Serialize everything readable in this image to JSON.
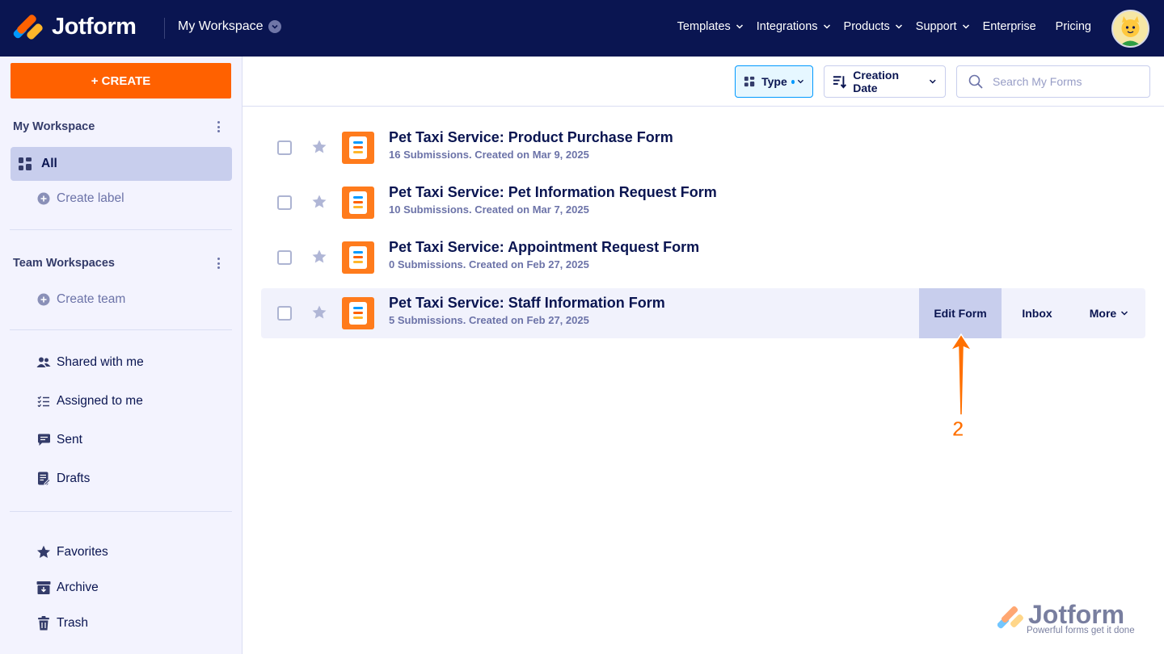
{
  "brand": {
    "name": "Jotform"
  },
  "header": {
    "workspace_label": "My Workspace",
    "nav": [
      {
        "label": "Templates",
        "has_menu": true
      },
      {
        "label": "Integrations",
        "has_menu": true
      },
      {
        "label": "Products",
        "has_menu": true
      },
      {
        "label": "Support",
        "has_menu": true
      },
      {
        "label": "Enterprise",
        "has_menu": false
      },
      {
        "label": "Pricing",
        "has_menu": false
      }
    ]
  },
  "sidebar": {
    "create_label": "+ CREATE",
    "my_workspace_title": "My Workspace",
    "all_label": "All",
    "create_label_link": "Create label",
    "team_workspaces_title": "Team Workspaces",
    "create_team_link": "Create team",
    "items": [
      {
        "label": "Shared with me",
        "icon": "users-icon"
      },
      {
        "label": "Assigned to me",
        "icon": "checklist-icon"
      },
      {
        "label": "Sent",
        "icon": "message-icon"
      },
      {
        "label": "Drafts",
        "icon": "draft-icon"
      }
    ],
    "bottom_items": [
      {
        "label": "Favorites",
        "icon": "star-icon"
      },
      {
        "label": "Archive",
        "icon": "archive-icon"
      },
      {
        "label": "Trash",
        "icon": "trash-icon"
      }
    ]
  },
  "toolbar": {
    "type_label": "Type",
    "sort_label": "Creation Date",
    "search_placeholder": "Search My Forms"
  },
  "forms": [
    {
      "title": "Pet Taxi Service: Product Purchase Form",
      "meta": "16 Submissions. Created on Mar 9, 2025"
    },
    {
      "title": "Pet Taxi Service: Pet Information Request Form",
      "meta": "10 Submissions. Created on Mar 7, 2025"
    },
    {
      "title": "Pet Taxi Service: Appointment Request Form",
      "meta": "0 Submissions. Created on Feb 27, 2025"
    },
    {
      "title": "Pet Taxi Service: Staff Information Form",
      "meta": "5 Submissions. Created on Feb 27, 2025"
    }
  ],
  "row_actions": {
    "edit": "Edit Form",
    "inbox": "Inbox",
    "more": "More"
  },
  "annotation": {
    "step": "2"
  },
  "watermark": {
    "name": "Jotform",
    "tagline": "Powerful forms get it done"
  },
  "colors": {
    "navy": "#0a1551",
    "orange": "#ff6100",
    "sidebar_bg": "#f3f3fe",
    "active": "#c8ceed",
    "accent_blue": "#0099ff"
  }
}
